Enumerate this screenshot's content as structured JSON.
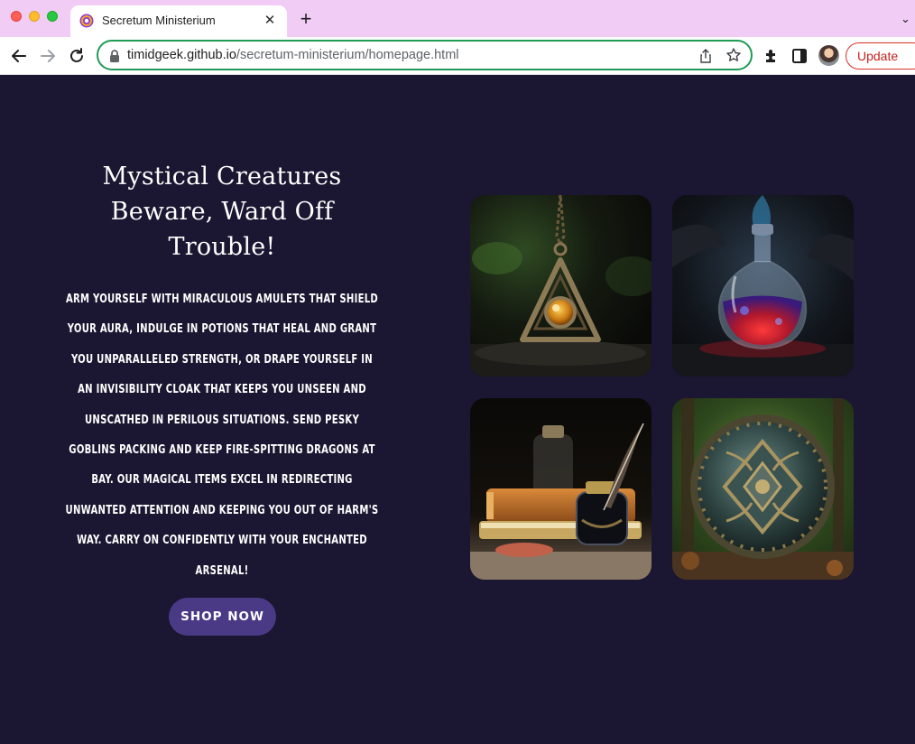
{
  "browser": {
    "tab_title": "Secretum Ministerium",
    "url_domain": "timidgeek.github.io",
    "url_path": "/secretum-ministerium/homepage.html",
    "update_label": "Update"
  },
  "hero": {
    "headline": "Mystical Creatures Beware, Ward Off Trouble!",
    "body": "Arm yourself with miraculous amulets that shield your aura, indulge in potions that heal and grant you unparalleled strength, or drape yourself in an invisibility cloak that keeps you unseen and unscathed in perilous situations. Send pesky goblins packing and keep fire-spitting dragons at bay. Our magical items excel in redirecting unwanted attention and keeping you out of harm's way. Carry on confidently with your enchanted arsenal!",
    "cta_label": "SHOP NOW"
  },
  "gallery": [
    {
      "image": "amulet-pendant"
    },
    {
      "image": "glowing-potion-bottle"
    },
    {
      "image": "ink-bottle-quill-books"
    },
    {
      "image": "ornate-shield"
    }
  ],
  "colors": {
    "page_background": "#1b1631",
    "cta_background": "#4a3a86",
    "tabbar": "#f1cdf6",
    "omnibox_border": "#1f9b55",
    "update_red": "#c5221f"
  }
}
